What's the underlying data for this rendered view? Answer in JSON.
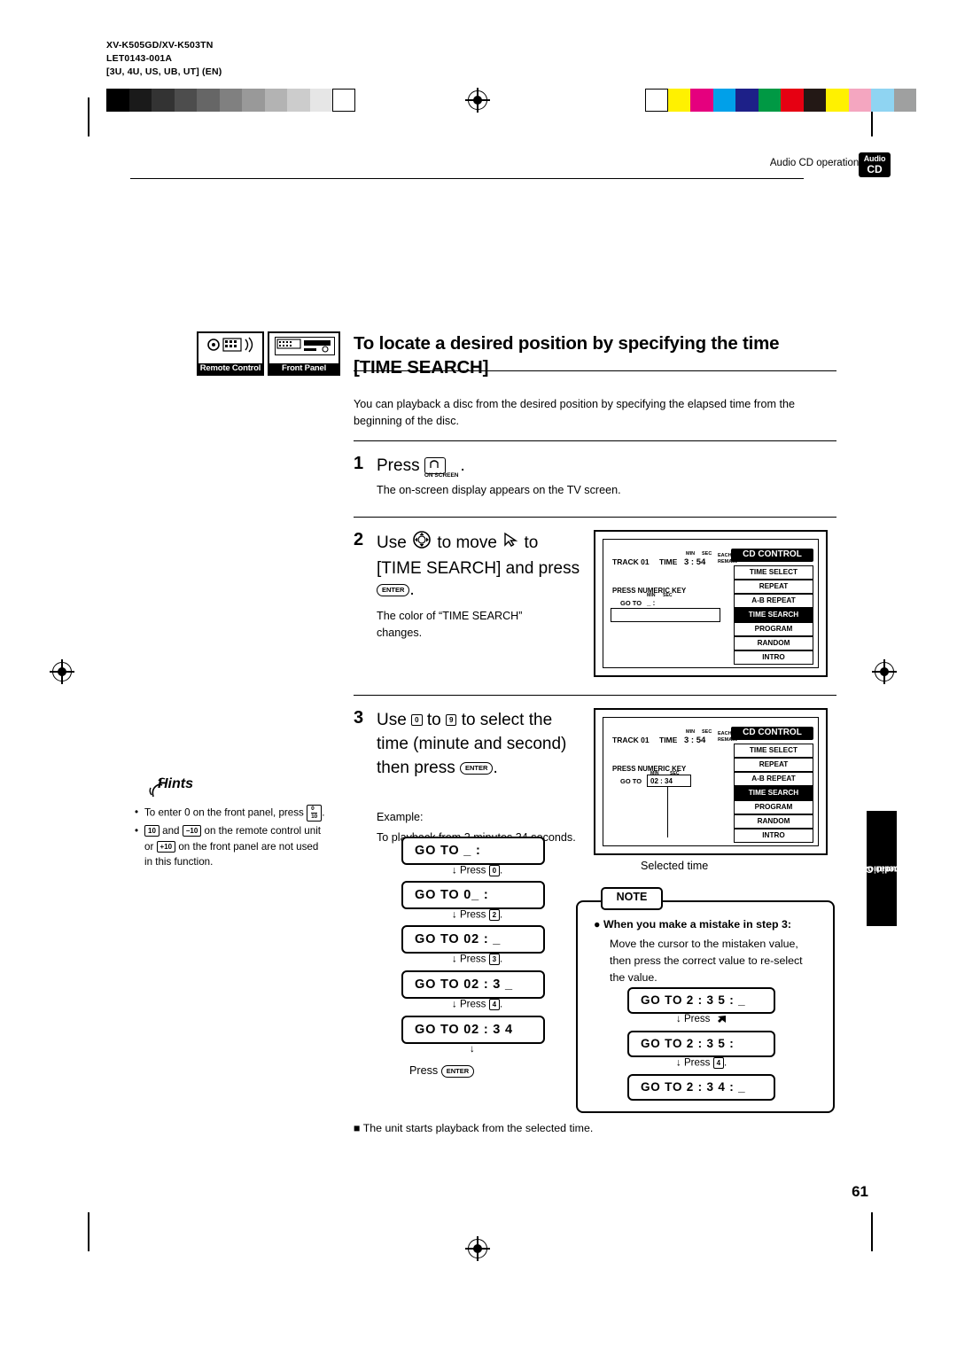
{
  "header": {
    "model": "XV-K505GD/XV-K503TN",
    "doc_code": "LET0143-001A",
    "market": "3U, 4U, US, UB, UT]  (EN)",
    "market_prefix": "[",
    "running_head": "Audio CD operations",
    "badge_top": "Audio",
    "badge_bottom": "CD"
  },
  "section": {
    "icon_remote_label": "Remote Control",
    "icon_front_label": "Front Panel",
    "title_line1": "To locate a desired position by specifying the time",
    "title_line2": "[TIME SEARCH]",
    "intro": "You can playback a disc from the desired position by specifying the elapsed time from the beginning of the disc."
  },
  "steps": {
    "s1_num": "1",
    "s1_text": "Press",
    "s1_key": "ON SCREEN",
    "s1_period": ".",
    "s1_sub": "The on-screen display appears on the TV screen.",
    "s2_num": "2",
    "s2_text_a": "Use",
    "s2_text_b": "to move",
    "s2_text_c": "to",
    "s2_text_d": "[TIME SEARCH] and press",
    "s2_key": "ENTER",
    "s2_period": ".",
    "s2_sub": "The color of “TIME SEARCH” changes.",
    "s3_num": "3",
    "s3_text_a": "Use",
    "s3_key_from": "0",
    "s3_text_b": "to",
    "s3_key_to": "9",
    "s3_text_c": "to select the",
    "s3_line2": "time (minute and second)",
    "s3_line3": "then press",
    "s3_key_enter": "ENTER",
    "s3_period": ".",
    "s3_example_label": "Example:",
    "s3_example_text": "To playback from 2 minutes 34 seconds."
  },
  "hints": {
    "title": "Hints",
    "items": [
      "To enter 0 on the front panel, press",
      "and",
      "on the remote control unit or",
      "on the front panel are not used in this function."
    ],
    "key_0_top": "0",
    "key_0_bottom": "10",
    "key_10": "10",
    "key_minus10": "10",
    "key_plus10": "+10"
  },
  "tv1": {
    "track_label": "TRACK 01",
    "time_label": "TIME",
    "min_label": "MIN",
    "sec_label": "SEC",
    "time_value": "3 : 54",
    "each_label": "EACH",
    "remain_label": "REMAIN",
    "numeric_prompt": "PRESS NUMERIC KEY",
    "goto_label": "GO TO",
    "goto_min": "MIN",
    "goto_sec": "SEC",
    "goto_value": "_  :",
    "cd_control": "CD CONTROL",
    "menu": [
      "TIME SELECT",
      "REPEAT",
      "A-B REPEAT",
      "TIME SEARCH",
      "PROGRAM",
      "RANDOM",
      "INTRO"
    ],
    "selected_menu": "TIME SEARCH"
  },
  "tv2": {
    "track_label": "TRACK 01",
    "time_label": "TIME",
    "min_label": "MIN",
    "sec_label": "SEC",
    "time_value": "3 : 54",
    "each_label": "EACH",
    "remain_label": "REMAIN",
    "numeric_prompt": "PRESS NUMERIC KEY",
    "goto_label": "GO TO",
    "goto_min": "MIN",
    "goto_sec": "SEC",
    "goto_value": "02 : 34",
    "cd_control": "CD CONTROL",
    "menu": [
      "TIME SELECT",
      "REPEAT",
      "A-B REPEAT",
      "TIME SEARCH",
      "PROGRAM",
      "RANDOM",
      "INTRO"
    ],
    "selected_menu": "TIME SEARCH",
    "callout": "Selected time"
  },
  "goto_sequence": [
    {
      "text": "GO TO _  :",
      "press": "Press",
      "num": "0"
    },
    {
      "text": "GO TO 0_  :",
      "press": "Press",
      "num": "2"
    },
    {
      "text": "GO TO 02 : _",
      "press": "Press",
      "num": "3"
    },
    {
      "text": "GO TO 02 : 3 _",
      "press": "Press",
      "num": "4"
    },
    {
      "text": "GO TO 02 : 3 4",
      "press": "Press",
      "num": ""
    }
  ],
  "goto_final_press": "Press",
  "goto_final_key": "ENTER",
  "note": {
    "tag": "NOTE",
    "heading": "When you make a mistake in step 3:",
    "body": "Move the cursor to the mistaken value, then press the correct value to re-select the value.",
    "boxes": [
      {
        "text": "GO TO  2 : 3 5 : _",
        "press": "Press",
        "num": ""
      },
      {
        "text": "GO TO  2 : 3 5 :",
        "press": "Press",
        "num": "4"
      },
      {
        "text": "GO TO  2 : 3 4 : _",
        "press": "",
        "num": ""
      }
    ]
  },
  "sidetab": {
    "line1": "Audio CD",
    "line2": "operations"
  },
  "footnote": "The unit starts playback from the selected time.",
  "pagenum": "61",
  "colors": {
    "ink": "#000000",
    "paper": "#ffffff",
    "bar_magenta": "#e5007e",
    "bar_cyan": "#00a0e9",
    "bar_yellow": "#fff100",
    "bar_blue": "#1d2088",
    "bar_green": "#009944",
    "bar_red": "#e60012",
    "bar_pink": "#f4a6c0"
  }
}
